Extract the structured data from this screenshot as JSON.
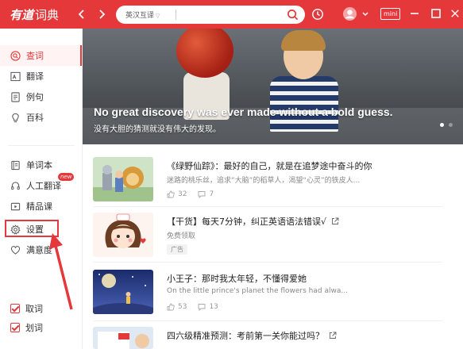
{
  "app": {
    "logo_main": "有道",
    "logo_sub": "词典"
  },
  "search": {
    "mode_label": "英汉互译",
    "value": "",
    "placeholder": ""
  },
  "toolbar": {
    "mini_label": "mini"
  },
  "sidebar": {
    "top_items": [
      {
        "label": "查词",
        "icon": "search-circle-icon",
        "active": true
      },
      {
        "label": "翻译",
        "icon": "translate-icon"
      },
      {
        "label": "例句",
        "icon": "sentence-icon"
      },
      {
        "label": "百科",
        "icon": "bulb-icon"
      }
    ],
    "bottom_items": [
      {
        "label": "单词本",
        "icon": "notebook-icon"
      },
      {
        "label": "人工翻译",
        "icon": "headset-icon",
        "badge": "new"
      },
      {
        "label": "精品课",
        "icon": "course-icon"
      },
      {
        "label": "设置",
        "icon": "gear-icon"
      },
      {
        "label": "满意度",
        "icon": "heart-icon"
      }
    ],
    "toggles": [
      {
        "label": "取词",
        "checked": true
      },
      {
        "label": "划词",
        "checked": true
      }
    ]
  },
  "banner": {
    "quote_en": "No great discovery was ever made without a bold guess.",
    "quote_zh": "没有大胆的猜测就没有伟大的发现。",
    "slide_count": 2,
    "active_slide": 1
  },
  "feed": [
    {
      "title": "《绿野仙踪》：最好的自己，就是在追梦途中奋斗的你",
      "subtitle": "迷路的桃乐丝，追求“大脑”的稻草人，渴望“心灵”的铁皮人...",
      "likes": "32",
      "comments": "7"
    },
    {
      "title": "【干货】每天7分钟，纠正英语语法错误√",
      "subtitle": "免费领取",
      "tag": "广告"
    },
    {
      "title": "小王子：那时我太年轻，不懂得爱她",
      "subtitle": "On the little prince's planet the flowers had alwa...",
      "likes": "53",
      "comments": "13"
    },
    {
      "title": "四六级精准预测：考前第一关你能过吗？"
    }
  ],
  "colors": {
    "brand_red": "#e5383b",
    "active_bg": "#fff3f3"
  }
}
